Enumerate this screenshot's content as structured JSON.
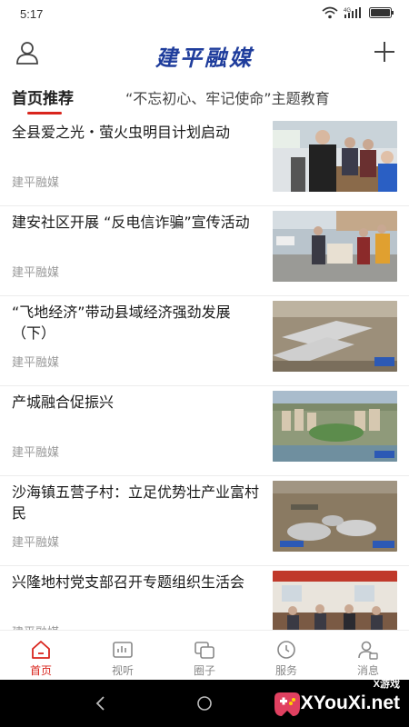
{
  "status_bar": {
    "time": "5:17",
    "network": "4G"
  },
  "header": {
    "title": "建平融媒"
  },
  "tabs": [
    {
      "label": "首页推荐",
      "active": true
    },
    {
      "label": "“不忘初心、牢记使命”主题教育"
    }
  ],
  "news": [
    {
      "title": "全县爱之光・萤火虫明目计划启动",
      "source": "建平融媒",
      "thumb": "people-screening-photo"
    },
    {
      "title": "建安社区开展 “反电信诈骗”宣传活动",
      "source": "建平融媒",
      "thumb": "outdoor-campaign-photo"
    },
    {
      "title": "“飞地经济”带动县域经济强劲发展（下）",
      "source": "建平融媒",
      "thumb": "industrial-park-aerial-photo"
    },
    {
      "title": "产城融合促振兴",
      "source": "建平融媒",
      "thumb": "city-aerial-photo"
    },
    {
      "title": "沙海镇五营子村：立足优势壮产业富村民",
      "source": "建平融媒",
      "thumb": "village-aerial-photo"
    },
    {
      "title": "兴隆地村党支部召开专题组织生活会",
      "source": "建平融媒",
      "thumb": "meeting-room-photo"
    }
  ],
  "bottom_nav": [
    {
      "label": "首页",
      "icon": "home-icon",
      "active": true
    },
    {
      "label": "视听",
      "icon": "media-icon"
    },
    {
      "label": "圈子",
      "icon": "circle-icon"
    },
    {
      "label": "服务",
      "icon": "clock-icon"
    },
    {
      "label": "消息",
      "icon": "message-icon"
    }
  ],
  "watermark": {
    "small": "X游戏",
    "text": "XYouXi.net"
  },
  "colors": {
    "accent": "#d9251d",
    "brand_blue": "#1f3d9c"
  }
}
